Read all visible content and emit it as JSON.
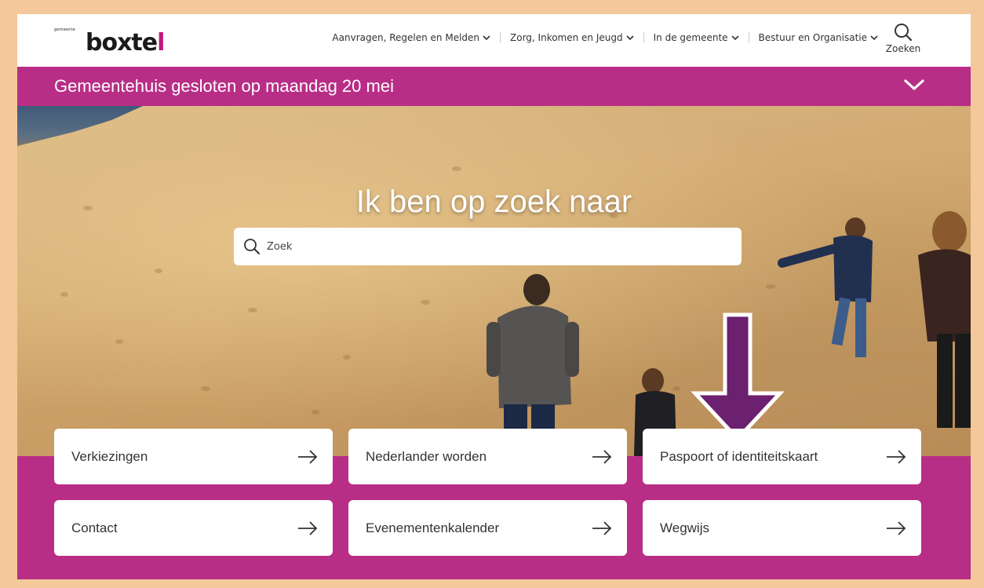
{
  "header": {
    "logo_small": "gemeente",
    "logo_text": "boxtel",
    "nav": [
      {
        "label": "Aanvragen, Regelen en Melden"
      },
      {
        "label": "Zorg, Inkomen en Jeugd"
      },
      {
        "label": "In de gemeente"
      },
      {
        "label": "Bestuur en Organisatie"
      }
    ],
    "search_label": "Zoeken"
  },
  "banner": {
    "text": "Gemeentehuis gesloten op maandag 20 mei"
  },
  "hero": {
    "title": "Ik ben op zoek naar",
    "search_placeholder": "Zoek"
  },
  "tiles": [
    {
      "label": "Verkiezingen"
    },
    {
      "label": "Nederlander worden"
    },
    {
      "label": "Paspoort of identiteitskaart"
    },
    {
      "label": "Contact"
    },
    {
      "label": "Evenementenkalender"
    },
    {
      "label": "Wegwijs"
    }
  ],
  "colors": {
    "brand": "#b82e86",
    "frame": "#f4c89a",
    "arrow": "#6b2070"
  }
}
